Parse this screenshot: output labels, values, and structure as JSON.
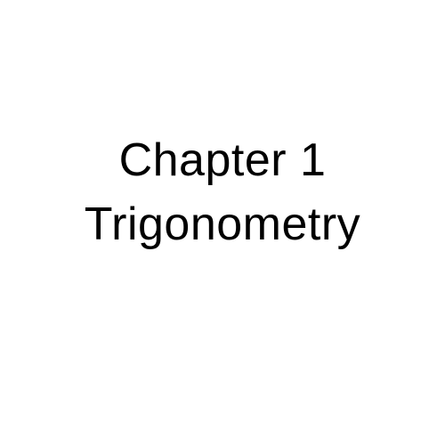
{
  "slide": {
    "chapter_label": "Chapter 1",
    "chapter_title": "Trigonometry"
  },
  "colors": {
    "background": "#ffffff",
    "text": "#000000"
  }
}
